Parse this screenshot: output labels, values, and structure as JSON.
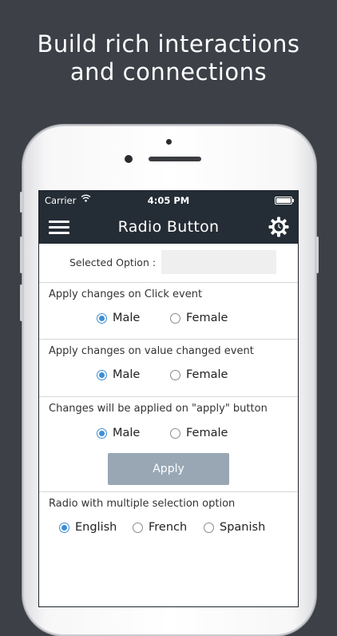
{
  "headline": {
    "line1": "Build rich interactions",
    "line2": "and connections"
  },
  "statusbar": {
    "carrier": "Carrier",
    "wifi_icon": "wifi-icon",
    "time": "4:05 PM",
    "battery_icon": "battery-icon"
  },
  "navbar": {
    "title": "Radio Button",
    "menu_icon": "hamburger-menu-icon",
    "settings_icon": "gear-icon"
  },
  "selected": {
    "label": "Selected Option :",
    "value": ""
  },
  "sections": [
    {
      "title": "Apply changes on Click event",
      "options": [
        "Male",
        "Female"
      ],
      "checked": 0
    },
    {
      "title": "Apply changes on value changed event",
      "options": [
        "Male",
        "Female"
      ],
      "checked": 0
    },
    {
      "title": "Changes will be applied on \"apply\" button",
      "options": [
        "Male",
        "Female"
      ],
      "checked": 0,
      "button": "Apply"
    },
    {
      "title": "Radio with multiple selection option",
      "options": [
        "English",
        "French",
        "Spanish"
      ],
      "checked": 0
    }
  ],
  "colors": {
    "background": "#3d4047",
    "navbar": "#242c35",
    "radio_checked": "#3c8fd6",
    "apply_button": "#99a7b5"
  }
}
